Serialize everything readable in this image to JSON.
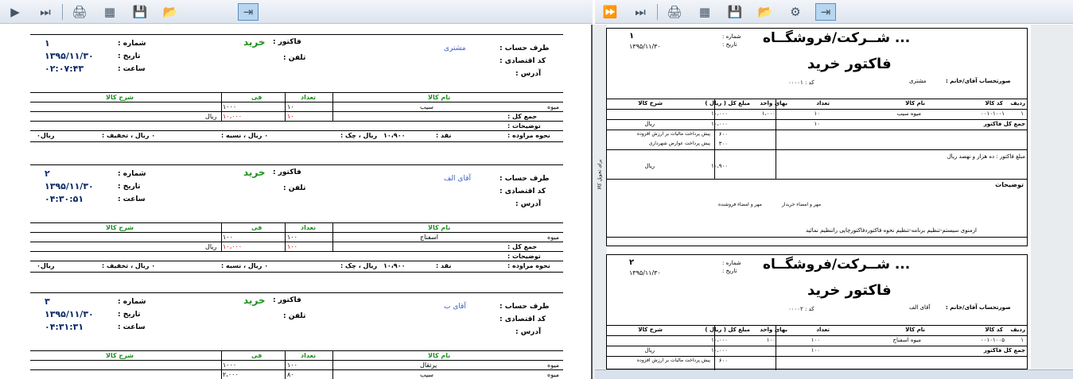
{
  "left_toolbar": {
    "icons": [
      "arrow-right-icon",
      "skip-end-icon",
      "printer-icon",
      "calculator-icon",
      "save-icon",
      "open-folder-icon",
      "export-icon"
    ]
  },
  "right_toolbar": {
    "icons": [
      "fast-forward-icon",
      "skip-end-icon",
      "printer-icon",
      "calculator-icon",
      "save-icon",
      "open-folder-icon",
      "tools-icon",
      "export-icon"
    ]
  },
  "left_invoices": [
    {
      "number": "۱",
      "date": "۱۳۹۵/۱۱/۳۰",
      "time": "۰۲:۰۷:۴۳",
      "account_name": "مشتری",
      "rows": [
        {
          "name": "سیب",
          "group": "میوه",
          "qty": "۱۰",
          "price": "۱۰۰۰"
        }
      ],
      "total_qty": "۱۰",
      "total_amount": "۱۰،۰۰۰",
      "cash": "۱۰،۹۰۰"
    },
    {
      "number": "۲",
      "date": "۱۳۹۵/۱۱/۳۰",
      "time": "۰۴:۳۰:۵۱",
      "account_name": "آقای الف",
      "rows": [
        {
          "name": "اسفناج",
          "group": "میوه",
          "qty": "۱۰۰",
          "price": "۱۰۰"
        }
      ],
      "total_qty": "۱۰۰",
      "total_amount": "۱۰،۰۰۰",
      "cash": "۱۰،۹۰۰"
    },
    {
      "number": "۳",
      "date": "۱۳۹۵/۱۱/۳۰",
      "time": "۰۴:۳۱:۳۱",
      "account_name": "آقای ب",
      "rows": [
        {
          "name": "پرتقال",
          "group": "میوه",
          "qty": "۱۰۰",
          "price": "۱۰۰۰"
        },
        {
          "name": "سیب",
          "group": "میوه",
          "qty": "۸۰",
          "price": "۲،۰۰۰"
        }
      ],
      "total_qty": "",
      "total_amount": "",
      "cash": ""
    }
  ],
  "labels": {
    "number": "شماره :",
    "date": "تاریخ :",
    "time": "ساعت :",
    "factor": "فاکتور :",
    "purchase": "خرید",
    "phone": "تلفن :",
    "account": "طرف حساب :",
    "econ_code": "کد اقتصادی :",
    "address": "آدرس :",
    "col_name": "نام کالا",
    "col_qty": "تعداد",
    "col_price": "فی",
    "col_desc": "شرح کالا",
    "total": "جمع کل :",
    "notes": "توضیحات :",
    "rial": "ریال",
    "payment": "نحوه مراوده :",
    "cash_label": "نقد :",
    "check": "ریال ، چک :",
    "credit": "۰ ریال ، نسیه :",
    "discount": "۰ ریال ، تخفیف :",
    "zero_rial": "۰ریال"
  },
  "right_invoices": [
    {
      "number": "۱",
      "date": "۱۳۹۵/۱۱/۳۰",
      "code": "کد : ۰۰۰۰۱",
      "account_name": "مشتری",
      "row": {
        "idx": "۱",
        "code": "۰۰۱۰۱۰۰۱",
        "name": "میوه سیب",
        "qty": "۱۰",
        "unit": "۱،۰۰۰",
        "amount": "۱۰،۰۰۰"
      },
      "total": "۱۰،۰۰۰",
      "vat": "۶۰۰",
      "municipal": "۳۰۰",
      "final": "۱۰،۹۰۰",
      "words": "مبلغ فاکتور : ده هزار و نهصد ریال"
    },
    {
      "number": "۲",
      "date": "۱۳۹۵/۱۱/۳۰",
      "code": "کد : ۰۰۰۰۲",
      "account_name": "آقای الف",
      "row": {
        "idx": "۱",
        "code": "۰۰۱۰۱۰۰۵",
        "name": "میوه اسفناج",
        "qty": "۱۰۰",
        "unit": "۱۰۰",
        "amount": "۱۰،۰۰۰"
      },
      "total": "۱۰،۰۰۰",
      "vat": "۶۰۰",
      "municipal": "",
      "final": "",
      "words": ""
    }
  ],
  "right_labels": {
    "company": "... شــرکت/فروشگــاه",
    "title": "فاکتور خرید",
    "number": "شماره :",
    "date": "تاریخ :",
    "account": "صورتحساب آقای/خانم :",
    "col_idx": "ردیف",
    "col_code": "کد کالا",
    "col_name": "نام کالا",
    "col_qty": "تعداد",
    "col_unit": "بهای واحد",
    "col_amount": "مبلغ کل ( ریال )",
    "col_desc": "شرح کالا",
    "grand_total": "جمع کل فاکتور",
    "rial": "ریال",
    "vat": "پیش پرداخت مالیات بر ارزش افزوده",
    "municipal": "پیش پرداخت عوارض شهرداری",
    "notes": "توضیحات",
    "buyer_sign": "مهر و امضاء خریدار",
    "seller_sign": "مهر و امضاء فروشنده",
    "footer": "ازمنوی سیستم-تنظیم برنامه-تنظیم نحوه فاکتوردفاکتورچاپی راتنظیم نمائید",
    "side_note": "برای تحویل کالا"
  }
}
